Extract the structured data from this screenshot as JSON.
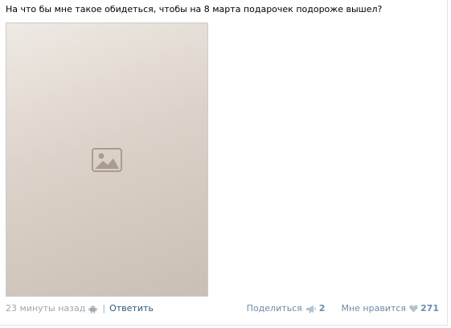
{
  "post": {
    "text": "На что бы мне такое обидеться, чтобы на 8 марта подарочек подороже вышел?"
  },
  "photo": {
    "icon": "image-placeholder-icon"
  },
  "footer": {
    "timestamp": "23 минуты назад",
    "device_icon": "android-icon",
    "separator": "|",
    "reply_label": "Ответить",
    "share_label": "Поделиться",
    "share_count": "2",
    "like_label": "Мне нравится",
    "like_count": "271"
  }
}
